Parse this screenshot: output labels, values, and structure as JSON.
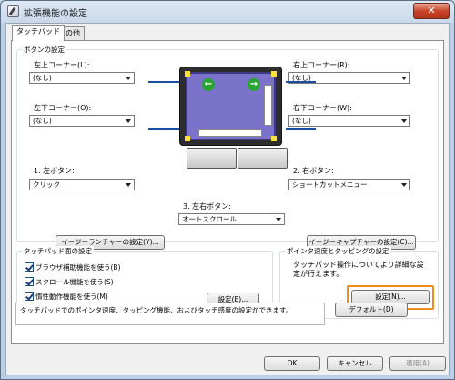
{
  "window": {
    "title": "拡張機能の設定",
    "close_label": "✕"
  },
  "tabs": [
    {
      "label": "タッチパッド"
    },
    {
      "label": "その他"
    }
  ],
  "buttons_group": {
    "label": "ボタンの設定",
    "top_left": {
      "label": "左上コーナー(L):",
      "value": "(なし)"
    },
    "top_right": {
      "label": "右上コーナー(R):",
      "value": "(なし)"
    },
    "bottom_left": {
      "label": "左下コーナー(O):",
      "value": "(なし)"
    },
    "bottom_right": {
      "label": "右下コーナー(W):",
      "value": "(なし)"
    },
    "left_button": {
      "label": "1. 左ボタン:",
      "value": "クリック"
    },
    "right_button": {
      "label": "2. 右ボタン:",
      "value": "ショートカットメニュー"
    },
    "both_buttons": {
      "label": "3. 左右ボタン:",
      "value": "オートスクロール"
    },
    "easy_launcher_label": "イージーランチャーの設定(Y)...",
    "easy_capture_label": "イージーキャプチャーの設定(C)..."
  },
  "pad_surface_group": {
    "label": "タッチパッド面の設定",
    "checks": [
      {
        "label": "ブラウザ補助機能を使う(B)",
        "checked": true
      },
      {
        "label": "スクロール機能を使う(S)",
        "checked": true
      },
      {
        "label": "慣性動作機能を使う(M)",
        "checked": true
      }
    ],
    "settings_label": "設定(E)..."
  },
  "speed_group": {
    "label": "ポインタ速度とタッピングの設定",
    "text": "タッチパッド操作についてより詳細な設定が行えます。",
    "settings_label": "設定(N)..."
  },
  "description": {
    "label": "説明",
    "text": "タッチパッドでのポインタ速度、タッピング機能、およびタッチ感度の設定ができます。"
  },
  "default_label": "デフォルト(D)",
  "footer": {
    "ok_label": "OK",
    "cancel_label": "キャンセル",
    "apply_label": "適用(A)"
  },
  "icons": {
    "back": "back-arrow-icon",
    "forward": "forward-arrow-icon"
  },
  "colors": {
    "accent_highlight": "#f28a1c",
    "pad_screen": "#7b73c9",
    "nav_green": "#27a434",
    "callout_line": "#1a4fa0",
    "corner_marker": "#ffe13a"
  }
}
